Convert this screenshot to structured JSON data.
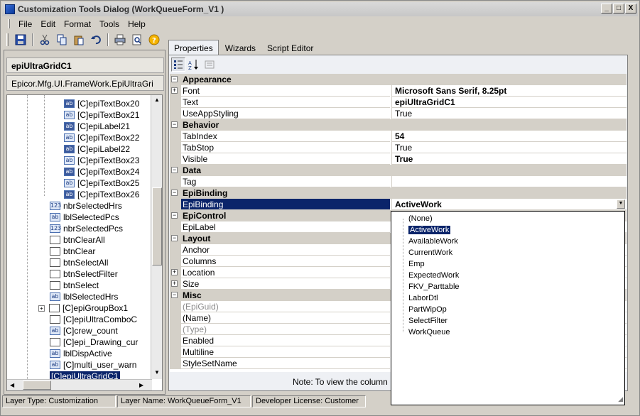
{
  "window": {
    "title": "Customization Tools Dialog  (WorkQueueForm_V1 )",
    "controls": [
      "_",
      "□",
      "X"
    ]
  },
  "menu": [
    "File",
    "Edit",
    "Format",
    "Tools",
    "Help"
  ],
  "toolbar": {
    "icons": [
      "save-icon",
      "cut-icon",
      "copy-icon",
      "paste-icon",
      "undo-icon",
      "print-icon",
      "print-preview-icon",
      "help-icon"
    ]
  },
  "left": {
    "selected_control": "epiUltraGridC1",
    "control_type": "Epicor.Mfg.UI.FrameWork.EpiUltraGri",
    "tree": [
      {
        "label": "[C]epiTextBox20",
        "icon": "ab",
        "level": 2
      },
      {
        "label": "[C]epiTextBox21",
        "icon": "ab",
        "level": 2
      },
      {
        "label": "[C]epiLabel21",
        "icon": "ab",
        "level": 2
      },
      {
        "label": "[C]epiTextBox22",
        "icon": "ab",
        "level": 2
      },
      {
        "label": "[C]epiLabel22",
        "icon": "ab",
        "level": 2
      },
      {
        "label": "[C]epiTextBox23",
        "icon": "ab",
        "level": 2
      },
      {
        "label": "[C]epiTextBox24",
        "icon": "ab",
        "level": 2
      },
      {
        "label": "[C]epiTextBox25",
        "icon": "ab",
        "level": 2
      },
      {
        "label": "[C]epiTextBox26",
        "icon": "ab",
        "level": 2
      },
      {
        "label": "nbrSelectedHrs",
        "icon": "123",
        "level": 1
      },
      {
        "label": "lblSelectedPcs",
        "icon": "ab",
        "level": 1
      },
      {
        "label": "nbrSelectedPcs",
        "icon": "123",
        "level": 1
      },
      {
        "label": "btnClearAll",
        "icon": "btn",
        "level": 1
      },
      {
        "label": "btnClear",
        "icon": "btn",
        "level": 1
      },
      {
        "label": "btnSelectAll",
        "icon": "btn",
        "level": 1
      },
      {
        "label": "btnSelectFilter",
        "icon": "btn",
        "level": 1
      },
      {
        "label": "btnSelect",
        "icon": "btn",
        "level": 1
      },
      {
        "label": "lblSelectedHrs",
        "icon": "ab",
        "level": 1
      },
      {
        "label": "[C]epiGroupBox1",
        "icon": "grp",
        "level": 1,
        "expander": "+"
      },
      {
        "label": "[C]epiUltraComboC",
        "icon": "combo",
        "level": 1
      },
      {
        "label": "[C]crew_count",
        "icon": "ab",
        "level": 1
      },
      {
        "label": "[C]epi_Drawing_cur",
        "icon": "btn",
        "level": 1
      },
      {
        "label": "lblDispActive",
        "icon": "ab",
        "level": 1
      },
      {
        "label": "[C]multi_user_warn",
        "icon": "ab",
        "level": 1
      },
      {
        "label": "[C]epiUltraGridC1",
        "icon": "grid",
        "level": 1,
        "selected": true
      }
    ]
  },
  "tabs": [
    {
      "label": "Properties",
      "active": true
    },
    {
      "label": "Wizards",
      "active": false
    },
    {
      "label": "Script Editor",
      "active": false
    }
  ],
  "properties": {
    "toolbar_icons": [
      "categorized-icon",
      "alphabetical-icon",
      "property-pages-icon"
    ],
    "rows": [
      {
        "type": "cat",
        "name": "Appearance",
        "exp": "−"
      },
      {
        "name": "Font",
        "value": "Microsoft Sans Serif, 8.25pt",
        "bold": true,
        "exp": "+"
      },
      {
        "name": "Text",
        "value": "epiUltraGridC1",
        "bold": true
      },
      {
        "name": "UseAppStyling",
        "value": "True"
      },
      {
        "type": "cat",
        "name": "Behavior",
        "exp": "−"
      },
      {
        "name": "TabIndex",
        "value": "54",
        "bold": true
      },
      {
        "name": "TabStop",
        "value": "True"
      },
      {
        "name": "Visible",
        "value": "True",
        "bold": true
      },
      {
        "type": "cat",
        "name": "Data",
        "exp": "−"
      },
      {
        "name": "Tag",
        "value": ""
      },
      {
        "type": "cat",
        "name": "EpiBinding",
        "exp": "−"
      },
      {
        "name": "EpiBinding",
        "value": "ActiveWork",
        "selected": true
      },
      {
        "type": "cat",
        "name": "EpiControl",
        "exp": "−"
      },
      {
        "name": "EpiLabel",
        "value": ""
      },
      {
        "type": "cat",
        "name": "Layout",
        "exp": "−"
      },
      {
        "name": "Anchor",
        "value": ""
      },
      {
        "name": "Columns",
        "value": ""
      },
      {
        "name": "Location",
        "value": "",
        "exp": "+"
      },
      {
        "name": "Size",
        "value": "",
        "exp": "+"
      },
      {
        "type": "cat",
        "name": "Misc",
        "exp": "−"
      },
      {
        "name": "(EpiGuid)",
        "value": "",
        "grey": true
      },
      {
        "name": "(Name)",
        "value": ""
      },
      {
        "name": "(Type)",
        "value": "",
        "grey": true
      },
      {
        "name": "Enabled",
        "value": ""
      },
      {
        "name": "Multiline",
        "value": ""
      },
      {
        "name": "StyleSetName",
        "value": ""
      }
    ],
    "note": "Note:  To view the column"
  },
  "dropdown": {
    "items": [
      "(None)",
      "ActiveWork",
      "AvailableWork",
      "CurrentWork",
      "Emp",
      "ExpectedWork",
      "FKV_Parttable",
      "LaborDtl",
      "PartWipOp",
      "SelectFilter",
      "WorkQueue"
    ],
    "selected": "ActiveWork"
  },
  "status": [
    "Layer Type:  Customization",
    "Layer Name:  WorkQueueForm_V1",
    "Developer License:  Customer"
  ]
}
